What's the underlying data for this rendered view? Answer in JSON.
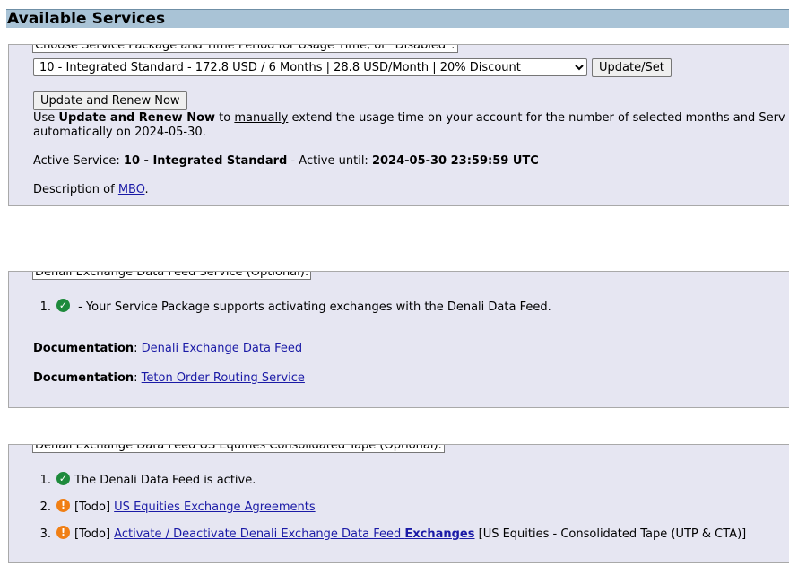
{
  "page": {
    "title": "Available Services"
  },
  "service_package": {
    "legend": "Choose Service Package and Time Period for Usage Time, or \"Disabled\":",
    "selected_option": "10 - Integrated Standard - 172.8 USD / 6 Months | 28.8 USD/Month | 20% Discount",
    "update_set_label": "Update/Set",
    "renew_label": "Update and Renew Now",
    "help_use": "Use ",
    "help_bold": "Update and Renew Now",
    "help_to": " to ",
    "help_manually": "manually",
    "help_rest": " extend the usage time on your account for the number of selected months and Serv",
    "help_line2": "automatically on 2024-05-30.",
    "active_prefix": "Active Service: ",
    "active_service_name": "10 - Integrated Standard",
    "active_until_label": " - Active until: ",
    "active_until_value": "2024-05-30 23:59:59 UTC",
    "description_prefix": "Description of ",
    "description_link": "MBO",
    "description_suffix": "."
  },
  "denali_feed": {
    "legend": "Denali Exchange Data Feed Service (Optional):",
    "items": [
      {
        "number": "1.",
        "status": "ok",
        "text": " - Your Service Package supports activating exchanges with the Denali Data Feed."
      }
    ],
    "docs": [
      {
        "label": "Documentation",
        "colon": ": ",
        "link": "Denali Exchange Data Feed"
      },
      {
        "label": "Documentation",
        "colon": ": ",
        "link": "Teton Order Routing Service"
      }
    ]
  },
  "consolidated_tape": {
    "legend": "Denali Exchange Data Feed US Equities Consolidated Tape (Optional):",
    "items": [
      {
        "number": "1.",
        "status": "ok",
        "text": "The Denali Data Feed is active."
      },
      {
        "number": "2.",
        "status": "todo",
        "prefix": "[Todo] ",
        "link": "US Equities Exchange Agreements"
      },
      {
        "number": "3.",
        "status": "todo",
        "prefix": "[Todo] ",
        "link": "Activate / Deactivate Denali Exchange Data Feed ",
        "link_bold": "Exchanges",
        "suffix": " [US Equities - Consolidated Tape (UTP & CTA)]"
      }
    ]
  },
  "icons": {
    "ok": "check-circle-icon",
    "todo": "exclamation-circle-icon"
  },
  "colors": {
    "header_bg": "#a9c3d6",
    "panel_bg": "#e6e6f2",
    "link": "#1a1aa6",
    "ok": "#1e8a3c",
    "todo": "#f07f15"
  }
}
